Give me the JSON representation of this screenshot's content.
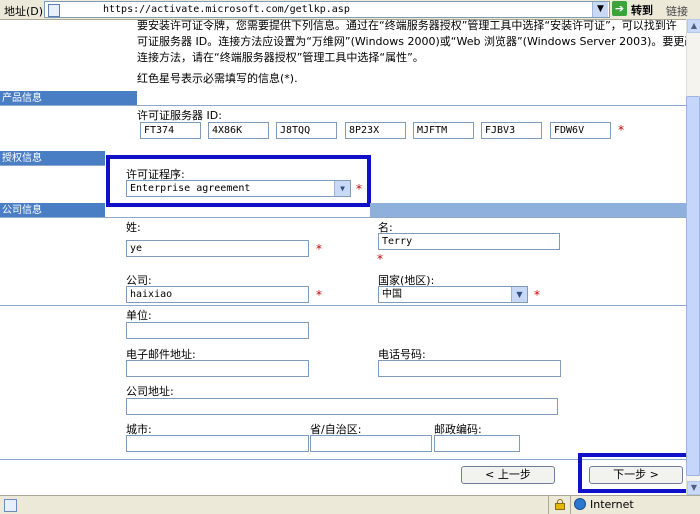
{
  "browser": {
    "address_label": "地址(D)",
    "url": "https://activate.microsoft.com/getlkp.asp",
    "go_label": "转到",
    "links_label": "链接",
    "status_text": "Internet"
  },
  "intro": {
    "line1": "要安装许可证令牌，您需要提供下列信息。通过在“终端服务器授权”管理工具中选择“安装许可证”，可以找到许",
    "line2": "可证服务器 ID。连接方法应设置为“万维网”(Windows 2000)或“Web 浏览器”(Windows Server 2003)。要更改",
    "line3": "连接方法，请在“终端服务器授权”管理工具中选择“属性”。",
    "required_note": "红色星号表示必需填写的信息(*)."
  },
  "sections": {
    "product": "产品信息",
    "license": "授权信息",
    "company": "公司信息"
  },
  "product": {
    "server_id_label": "许可证服务器 ID:",
    "server_id_parts": [
      "FT374",
      "4X86K",
      "J8TQQ",
      "8P23X",
      "MJFTM",
      "FJBV3",
      "FDW6V"
    ]
  },
  "license": {
    "program_label": "许可证程序:",
    "program_value": "Enterprise agreement"
  },
  "company": {
    "last_name_label": "姓:",
    "last_name_value": "ye",
    "first_name_label": "名:",
    "first_name_value": "Terry",
    "company_label": "公司:",
    "company_value": "haixiao",
    "country_label": "国家(地区):",
    "country_value": "中国",
    "org_label": "单位:",
    "org_value": "",
    "email_label": "电子邮件地址:",
    "email_value": "",
    "phone_label": "电话号码:",
    "phone_value": "",
    "address_label": "公司地址:",
    "address_value": "",
    "city_label": "城市:",
    "city_value": "",
    "state_label": "省/自治区:",
    "state_value": "",
    "zip_label": "邮政编码:",
    "zip_value": ""
  },
  "required_star": "*",
  "buttons": {
    "back": "< 上一步",
    "next": "下一步 >"
  },
  "colors": {
    "section_band": "#4a7ec4",
    "highlight": "#1010c8",
    "required": "#cc0000"
  }
}
